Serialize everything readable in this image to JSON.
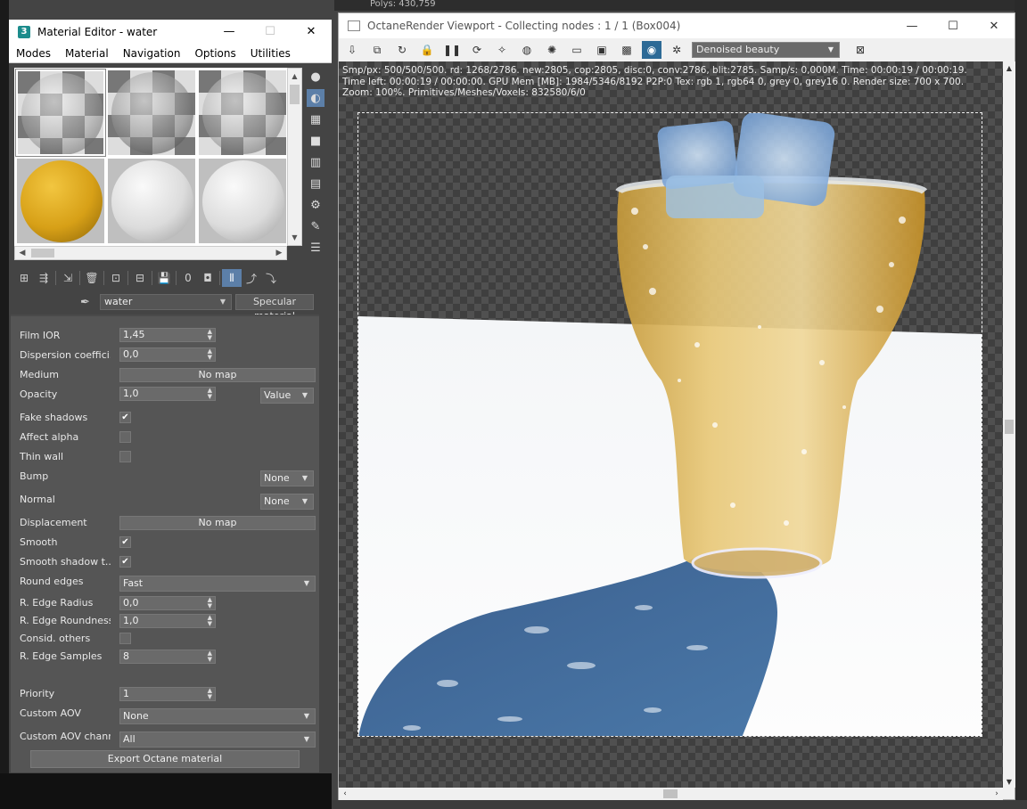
{
  "background": {
    "top_strip_text": "Polys: 430,759"
  },
  "material_editor": {
    "title": "Material Editor - water",
    "logo_text": "3",
    "menu": [
      "Modes",
      "Material",
      "Navigation",
      "Options",
      "Utilities"
    ],
    "material_name": "water",
    "material_type": "Specular material",
    "params": {
      "film_ior": {
        "label": "Film IOR",
        "value": "1,45"
      },
      "dispersion": {
        "label": "Dispersion coeffici...",
        "value": "0,0"
      },
      "medium": {
        "label": "Medium",
        "value": "No map"
      },
      "opacity": {
        "label": "Opacity",
        "value": "1,0",
        "mode": "Value"
      },
      "fake_shadows": {
        "label": "Fake shadows",
        "checked": true
      },
      "affect_alpha": {
        "label": "Affect alpha",
        "checked": false
      },
      "thin_wall": {
        "label": "Thin wall",
        "checked": false
      },
      "bump": {
        "label": "Bump",
        "value": "None"
      },
      "normal": {
        "label": "Normal",
        "value": "None"
      },
      "displacement": {
        "label": "Displacement",
        "value": "No map"
      },
      "smooth": {
        "label": "Smooth",
        "checked": true
      },
      "smooth_shadow": {
        "label": "Smooth shadow t...",
        "checked": true
      },
      "round_edges": {
        "label": "Round edges",
        "value": "Fast"
      },
      "edge_radius": {
        "label": "R. Edge Radius",
        "value": "0,0"
      },
      "edge_roundness": {
        "label": "R. Edge Roundness",
        "value": "1,0"
      },
      "consid_others": {
        "label": "Consid. others",
        "checked": false
      },
      "edge_samples": {
        "label": "R. Edge Samples",
        "value": "8"
      },
      "priority": {
        "label": "Priority",
        "value": "1"
      },
      "custom_aov": {
        "label": "Custom AOV",
        "value": "None"
      },
      "custom_aov_channel": {
        "label": "Custom AOV channel",
        "value": "All"
      }
    },
    "export_label": "Export Octane material",
    "check_mark": "✔"
  },
  "viewport": {
    "title": "OctaneRender Viewport - Collecting nodes : 1 / 1 (Box004)",
    "view_mode": "Denoised beauty",
    "stats": [
      "Smp/px: 500/500/500.   rd: 1268/2786.   new:2805, cop:2805, disc:0, conv:2786, blit:2785.   Samp/s: 0,000M.   Time: 00:00:19 / 00:00:19.",
      "Time left: 00:00:19 / 00:00:00.   GPU Mem [MB]: 1984/5346/8192 P2P:0   Tex: rgb 1, rgb64 0, grey 0, grey16 0.   Render size: 700 x 700.",
      "Zoom: 100%.   Primitives/Meshes/Voxels: 832580/6/0"
    ]
  },
  "colors": {
    "accent": "#2d6a96",
    "panel": "#555555",
    "liquid": "#e0b050",
    "shadow": "#3f6a98"
  }
}
